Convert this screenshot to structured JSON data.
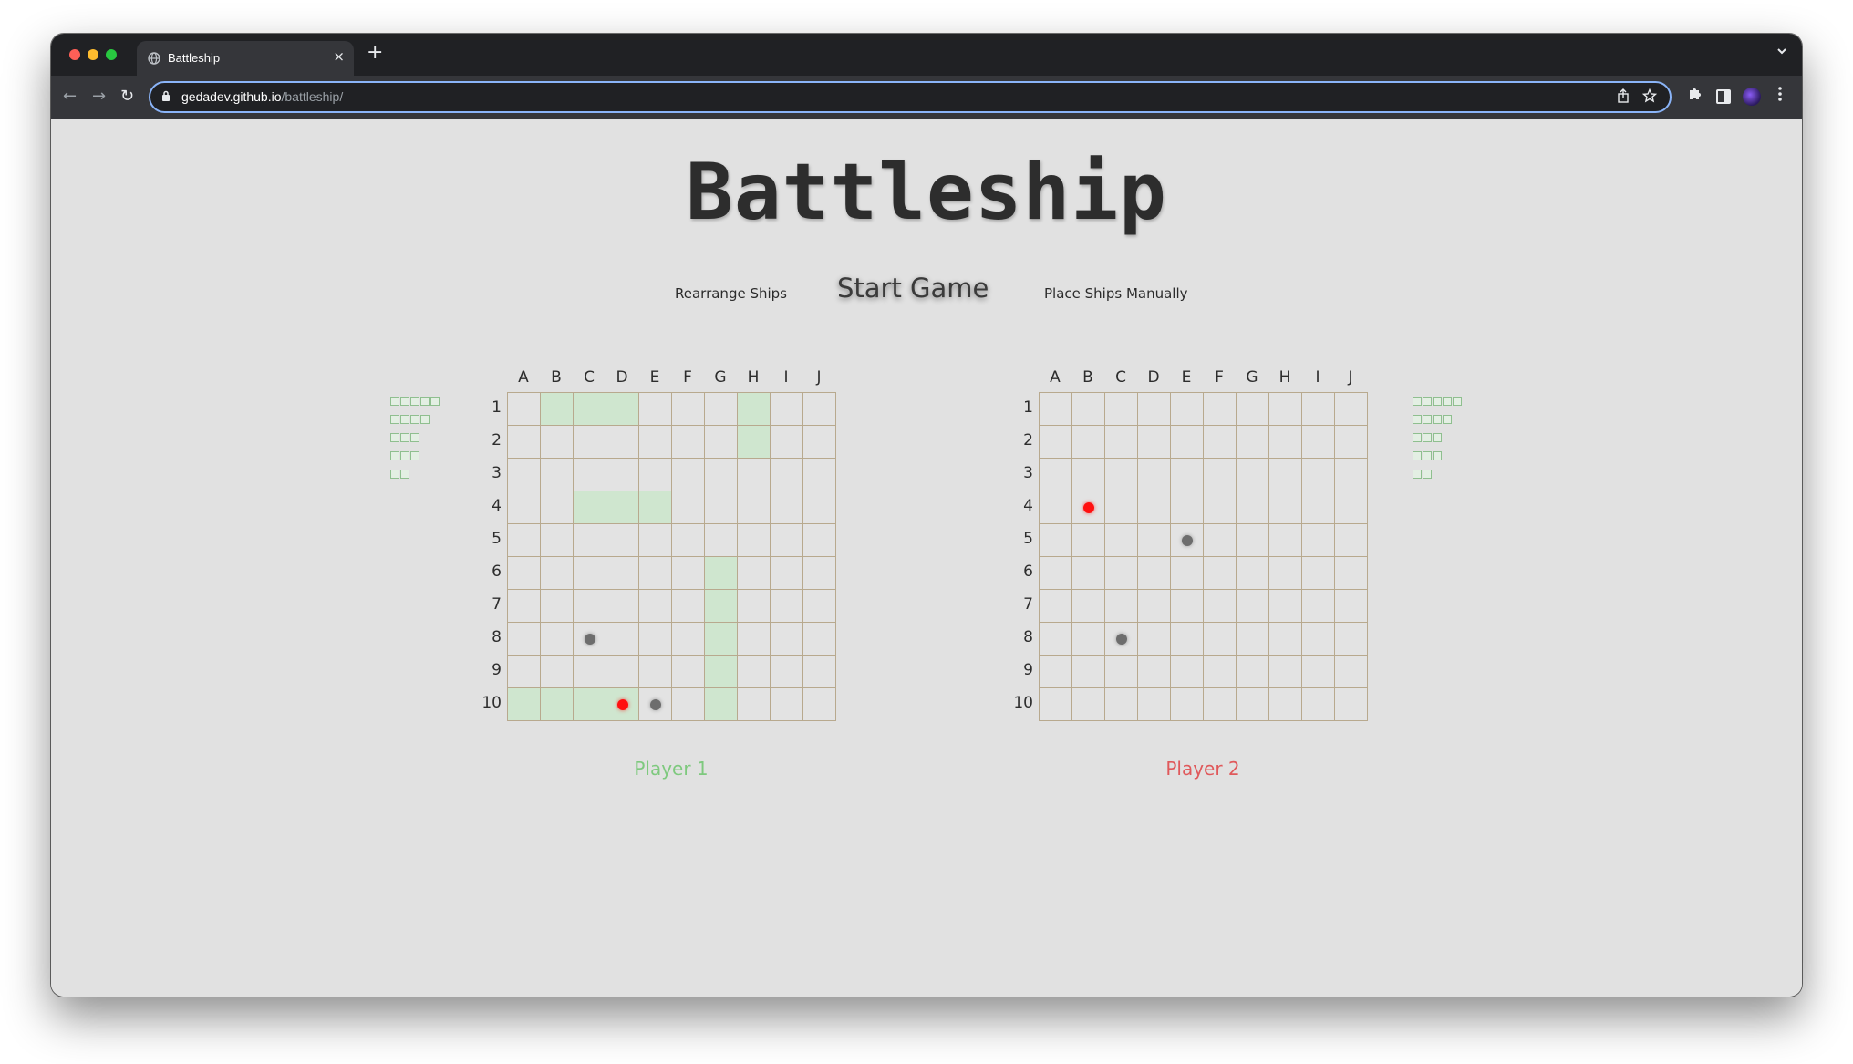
{
  "browser": {
    "tab_title": "Battleship",
    "tab_close": "×",
    "new_tab": "+",
    "url_host": "gedadev.github.io",
    "url_path": "/battleship/"
  },
  "page": {
    "title": "Battleship",
    "controls": {
      "rearrange_label": "Rearrange Ships",
      "start_label": "Start Game",
      "manual_label": "Place Ships Manually"
    }
  },
  "board_columns": [
    "A",
    "B",
    "C",
    "D",
    "E",
    "F",
    "G",
    "H",
    "I",
    "J"
  ],
  "board_rows": [
    "1",
    "2",
    "3",
    "4",
    "5",
    "6",
    "7",
    "8",
    "9",
    "10"
  ],
  "fleet_sizes": [
    5,
    4,
    3,
    3,
    2
  ],
  "players": [
    {
      "name": "Player 1",
      "color": "#7ec97e",
      "ship_cells": [
        "B1",
        "C1",
        "D1",
        "H1",
        "H2",
        "C4",
        "D4",
        "E4",
        "G6",
        "G7",
        "G8",
        "G9",
        "G10",
        "A10",
        "B10",
        "C10",
        "D10"
      ],
      "hits": [
        "D10"
      ],
      "misses": [
        "C8",
        "E10"
      ]
    },
    {
      "name": "Player 2",
      "color": "#e0595b",
      "ship_cells": [],
      "hits": [
        "B4"
      ],
      "misses": [
        "E5",
        "C8"
      ]
    }
  ],
  "colors": {
    "hit": "#ff1010",
    "miss": "#6d6d6d",
    "ship_cell": "#cfe6cf",
    "address_focus": "#8ab4f8"
  },
  "icons": [
    "globe-icon",
    "close-icon",
    "plus-icon",
    "back-arrow-icon",
    "forward-arrow-icon",
    "reload-icon",
    "lock-icon",
    "share-icon",
    "star-icon",
    "puzzle-icon",
    "side-panel-icon",
    "profile-avatar",
    "kebab-menu-icon",
    "chevron-down-icon"
  ]
}
